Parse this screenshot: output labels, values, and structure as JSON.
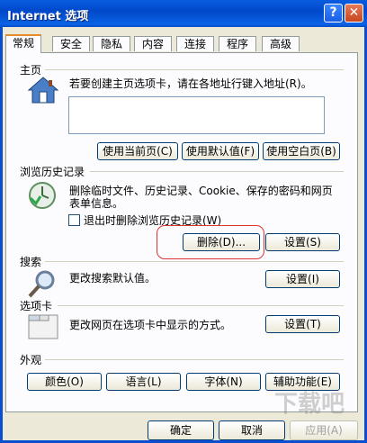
{
  "window": {
    "title": "Internet 选项"
  },
  "tabs": [
    {
      "label": "常规",
      "active": true
    },
    {
      "label": "安全"
    },
    {
      "label": "隐私"
    },
    {
      "label": "内容"
    },
    {
      "label": "连接"
    },
    {
      "label": "程序"
    },
    {
      "label": "高级"
    }
  ],
  "homepage": {
    "heading": "主页",
    "desc": "若要创建主页选项卡，请在各地址行键入地址(R)。",
    "address_value": "",
    "buttons": {
      "current": "使用当前页(C)",
      "default": "使用默认值(F)",
      "blank": "使用空白页(B)"
    }
  },
  "history": {
    "heading": "浏览历史记录",
    "desc_line1": "删除临时文件、历史记录、Cookie、保存的密码和网页",
    "desc_line2": "表单信息。",
    "checkbox_label": "退出时删除浏览历史记录(W)",
    "checkbox_checked": false,
    "delete_button": "删除(D)...",
    "settings_button": "设置(S)"
  },
  "search": {
    "heading": "搜索",
    "desc": "更改搜索默认值。",
    "settings_button": "设置(I)"
  },
  "tabs_section": {
    "heading": "选项卡",
    "desc": "更改网页在选项卡中显示的方式。",
    "settings_button": "设置(T)"
  },
  "appearance": {
    "heading": "外观",
    "buttons": {
      "colors": "颜色(O)",
      "languages": "语言(L)",
      "fonts": "字体(N)",
      "accessibility": "辅助功能(E)"
    }
  },
  "footer": {
    "ok": "确定",
    "cancel": "取消",
    "apply": "应用(A)"
  },
  "watermark": "下载吧",
  "colors": {
    "titlebar": "#0a5ce0",
    "highlight_ring": "#dd3333",
    "panel": "#fcfcfe",
    "dialog": "#ece9d8"
  }
}
